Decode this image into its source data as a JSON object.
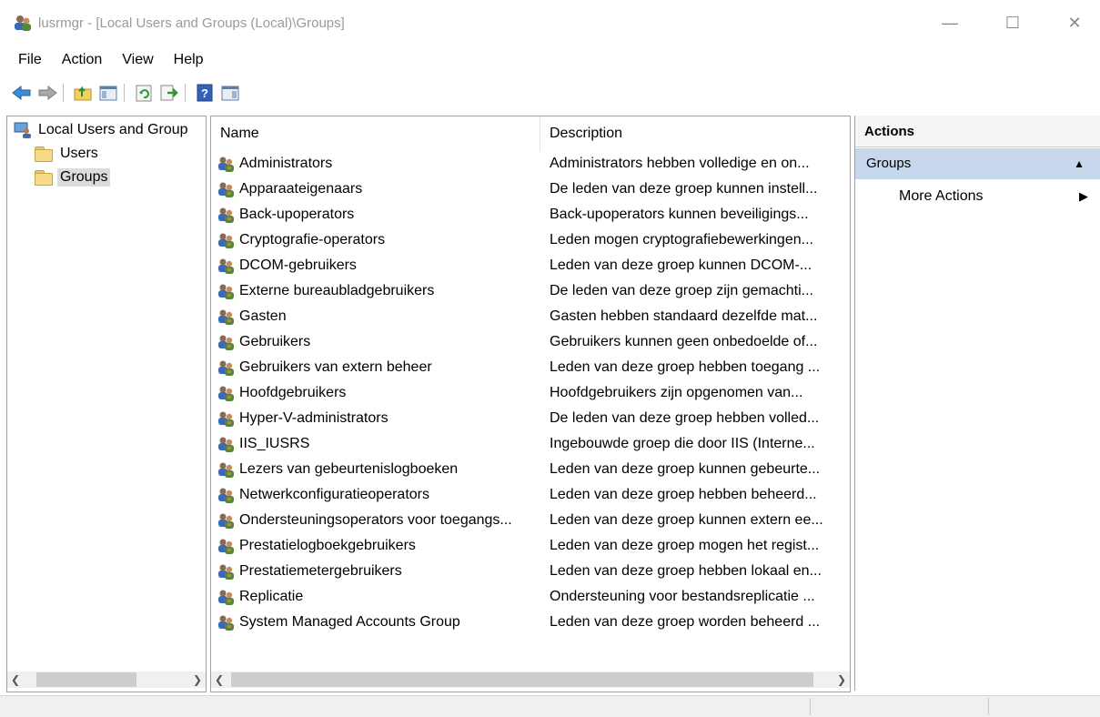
{
  "window": {
    "title": "lusrmgr - [Local Users and Groups (Local)\\Groups]",
    "controls": {
      "minimize": "—",
      "maximize": "☐",
      "close": "✕"
    }
  },
  "menu": [
    "File",
    "Action",
    "View",
    "Help"
  ],
  "toolbar": {
    "icons": [
      "back-arrow-icon",
      "forward-arrow-icon",
      "up-folder-icon",
      "show-hide-console-tree-icon",
      "refresh-icon",
      "export-list-icon",
      "help-icon",
      "show-hide-action-pane-icon"
    ]
  },
  "tree": {
    "root": "Local Users and Group",
    "children": [
      "Users",
      "Groups"
    ],
    "selected": "Groups"
  },
  "list": {
    "columns": [
      "Name",
      "Description"
    ],
    "rows": [
      {
        "name": "Administrators",
        "description": "Administrators hebben volledige en on..."
      },
      {
        "name": "Apparaateigenaars",
        "description": "De leden van deze groep kunnen instell..."
      },
      {
        "name": "Back-upoperators",
        "description": "Back-upoperators kunnen beveiligings..."
      },
      {
        "name": "Cryptografie-operators",
        "description": "Leden mogen cryptografiebewerkingen..."
      },
      {
        "name": "DCOM-gebruikers",
        "description": "Leden van deze groep kunnen DCOM-..."
      },
      {
        "name": "Externe bureaubladgebruikers",
        "description": "De leden van deze groep zijn gemachti..."
      },
      {
        "name": "Gasten",
        "description": "Gasten hebben standaard dezelfde mat..."
      },
      {
        "name": "Gebruikers",
        "description": "Gebruikers kunnen geen onbedoelde of..."
      },
      {
        "name": "Gebruikers van extern beheer",
        "description": "Leden van deze groep hebben toegang ..."
      },
      {
        "name": "Hoofdgebruikers",
        "description": "Hoofdgebruikers zijn opgenomen van..."
      },
      {
        "name": "Hyper-V-administrators",
        "description": "De leden van deze groep hebben volled..."
      },
      {
        "name": "IIS_IUSRS",
        "description": "Ingebouwde groep die door IIS (Interne..."
      },
      {
        "name": "Lezers van gebeurtenislogboeken",
        "description": "Leden van deze groep kunnen gebeurte..."
      },
      {
        "name": "Netwerkconfiguratieoperators",
        "description": "Leden van deze groep hebben beheerd..."
      },
      {
        "name": "Ondersteuningsoperators voor toegangs...",
        "description": "Leden van deze groep kunnen extern ee..."
      },
      {
        "name": "Prestatielogboekgebruikers",
        "description": "Leden van deze groep mogen het regist..."
      },
      {
        "name": "Prestatiemetergebruikers",
        "description": "Leden van deze groep hebben lokaal en..."
      },
      {
        "name": "Replicatie",
        "description": "Ondersteuning voor bestandsreplicatie ..."
      },
      {
        "name": "System Managed Accounts Group",
        "description": "Leden van deze groep worden beheerd ..."
      }
    ]
  },
  "actions": {
    "title": "Actions",
    "group": "Groups",
    "more_actions": "More Actions"
  },
  "colors": {
    "selection": "#dcdcdc",
    "actions_header": "#c7d7ec",
    "title_text": "#9a9a9a"
  }
}
